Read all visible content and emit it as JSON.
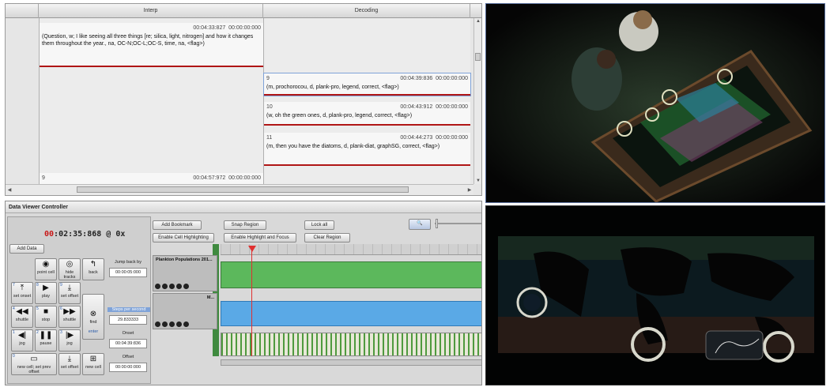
{
  "spreadsheet": {
    "columns": [
      "Interp",
      "Decoding"
    ],
    "interp_cells": [
      {
        "index": "",
        "onset": "00:04:33:827",
        "offset": "00:00:00:000",
        "text": "(Question, w; I like seeing all three things [re; silica, light, nitrogen] and how it changes them throughout the year., na, OC-N;OC-L;OC-S, time, na, <flag>)"
      },
      {
        "index": "9",
        "onset": "00:04:57:972",
        "offset": "00:00:00:000",
        "text": ""
      }
    ],
    "decoding_cells": [
      {
        "index": "9",
        "onset": "00:04:39:836",
        "offset": "00:00:00:000",
        "text": "(m, prochorocou, d, plank-pro, legend, correct, <flag>)"
      },
      {
        "index": "10",
        "onset": "00:04:43:912",
        "offset": "00:00:00:000",
        "text": "(w, oh the green ones, d, plank-pro, legend, correct, <flag>)"
      },
      {
        "index": "11",
        "onset": "00:04:44:273",
        "offset": "00:00:00:000",
        "text": "(m, then you have the diatoms, d, plank-diat, graphSG, correct, <flag>)"
      }
    ]
  },
  "controller": {
    "title": "Data Viewer Controller",
    "clock_prefix": "00",
    "clock_rest": ":02:35:868 @ 0x",
    "add_data": "Add Data",
    "top_buttons": {
      "add_bookmark": "Add Bookmark",
      "snap_region": "Snap Region",
      "lock_all": "Lock all",
      "enable_cell_highlighting": "Enable Cell Highlighting",
      "enable_highlight_focus": "Enable Highlight and Focus",
      "clear_region": "Clear Region"
    },
    "keys": [
      {
        "label": "point cell",
        "glyph": "◉"
      },
      {
        "label": "hide tracks",
        "glyph": "◎"
      },
      {
        "label": "back",
        "glyph": "↰"
      },
      {
        "label": "set onset",
        "glyph": "⤒"
      },
      {
        "label": "play",
        "glyph": "▶"
      },
      {
        "label": "set offset",
        "glyph": "⤓"
      },
      {
        "label": "shuttle",
        "glyph": "◀◀"
      },
      {
        "label": "stop",
        "glyph": "■"
      },
      {
        "label": "shuttle",
        "glyph": "▶▶"
      },
      {
        "label": "find",
        "glyph": "⊗"
      },
      {
        "label": "jog",
        "glyph": "◀|"
      },
      {
        "label": "pause",
        "glyph": "❚❚"
      },
      {
        "label": "jog",
        "glyph": "|▶"
      },
      {
        "label": "new cell",
        "glyph": "✚"
      },
      {
        "label": "set offset",
        "glyph": "⤓"
      },
      {
        "label": "new cell",
        "glyph": "⊞"
      }
    ],
    "bottom_wide_key": "new cell; set prev offset",
    "jump_back_label": "Jump back by",
    "jump_back_value": "00:00:05:000",
    "steps_label": "Steps per second",
    "steps_value": "29.833333",
    "onset_label": "Onset",
    "onset_value": "00:04:39:836",
    "offset_label": "Offset",
    "offset_value": "00:00:00:000",
    "enter_label": "enter",
    "track1_name": "Plankton Populations 201...",
    "track2_name": "M..."
  },
  "colors": {
    "track_green": "#5cb85c",
    "track_blue": "#5aa9e6",
    "rule_red": "#b01515",
    "needle_red": "#e03030"
  }
}
